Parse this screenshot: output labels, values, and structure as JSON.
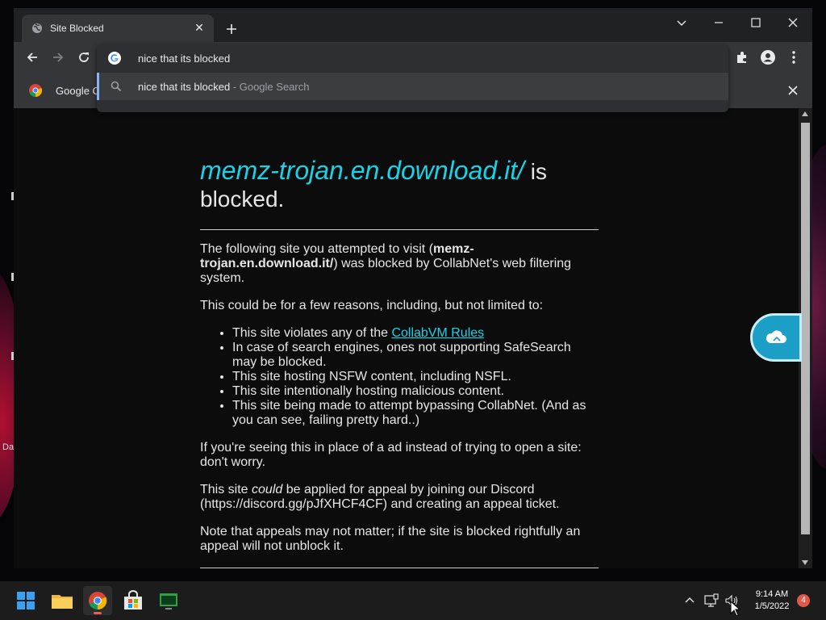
{
  "browser": {
    "tab": {
      "title": "Site Blocked",
      "favicon": "globe-icon",
      "close_icon": "close-icon"
    },
    "new_tab_icon": "plus-icon",
    "window_controls": [
      "chevron-down-icon",
      "minimize-icon",
      "maximize-icon",
      "close-icon"
    ],
    "nav": [
      "back-arrow-icon",
      "forward-arrow-icon",
      "reload-icon"
    ],
    "omnibox": {
      "text": "nice that its blocked",
      "icon": "google-g-icon"
    },
    "suggestion": {
      "query": "nice that its blocked",
      "suffix": " - Google Search",
      "icon": "search-icon"
    },
    "toolbar_icons": [
      "extensions-puzzle-icon",
      "profile-icon",
      "kebab-menu-icon"
    ],
    "bookmark": {
      "label": "Google C",
      "icon": "chrome-icon"
    }
  },
  "page": {
    "blocked_domain": "memz-trojan.en.download.it/",
    "headline_suffix": " is blocked.",
    "intro_before": "The following site you attempted to visit (",
    "intro_domain": "memz-trojan.en.download.it/",
    "intro_after": ") was blocked by CollabNet's web filtering system.",
    "reasons_intro": "This could be for a few reasons, including, but not limited to:",
    "reason1_before": "This site violates any of the ",
    "reason1_link": "CollabVM Rules",
    "reasons": [
      "In case of search engines, ones not supporting SafeSearch may be blocked.",
      "This site hosting NSFW content, including NSFL.",
      "This site intentionally hosting malicious content.",
      "This site being made to attempt bypassing CollabNet. (And as you can see, failing pretty hard..)"
    ],
    "ad_note": "If you're seeing this in place of a ad instead of trying to open a site: don't worry.",
    "appeal_before": "This site ",
    "appeal_em": "could",
    "appeal_after": " be applied for appeal by joining our Discord (https://discord.gg/pJfXHCF4CF) and creating an appeal ticket.",
    "appeal_note": "Note that appeals may not matter; if the site is blocked rightfully an appeal will not unblock it."
  },
  "desktop": {
    "label": "Da"
  },
  "taskbar": {
    "apps": [
      "windows-start-icon",
      "file-explorer-icon",
      "chrome-icon",
      "store-icon",
      "terminal-icon"
    ],
    "tray": [
      "chevron-up-icon",
      "network-icon",
      "volume-icon"
    ],
    "time": "9:14 AM",
    "date": "1/5/2022",
    "notifications": "4"
  },
  "colors": {
    "accent_cyan": "#18d3e6",
    "chrome_dark": "#202124",
    "tab_bar": "#35363a",
    "badge": "#e05a4a"
  }
}
